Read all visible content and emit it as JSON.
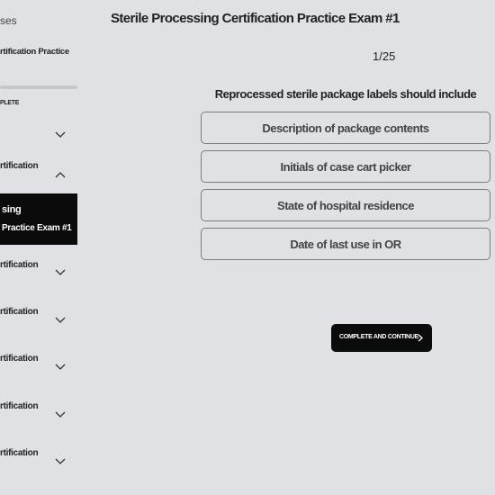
{
  "sidebar": {
    "back_link": "ses",
    "course_title": "rtification Practice",
    "progress_label": "PLETE",
    "progress_fraction": null,
    "sections": [
      {
        "label": "",
        "expanded": false
      },
      {
        "label": "rtification",
        "expanded": true
      },
      {
        "label": "rtification",
        "expanded": false
      },
      {
        "label": "rtification",
        "expanded": false
      },
      {
        "label": "rtification",
        "expanded": false
      },
      {
        "label": "rtification",
        "expanded": false
      },
      {
        "label": "rtification",
        "expanded": false
      }
    ],
    "active_lesson": {
      "line1": "sing",
      "line2": "Practice Exam #1"
    }
  },
  "main": {
    "title": "Sterile Processing Certification Practice Exam #1",
    "counter": "1/25",
    "question": "Reprocessed sterile package labels should include",
    "options": [
      "Description of package contents",
      "Initials of case cart picker",
      "State of hospital residence",
      "Date of last use in OR"
    ],
    "continue_button": "COMPLETE AND CONTINUE"
  }
}
